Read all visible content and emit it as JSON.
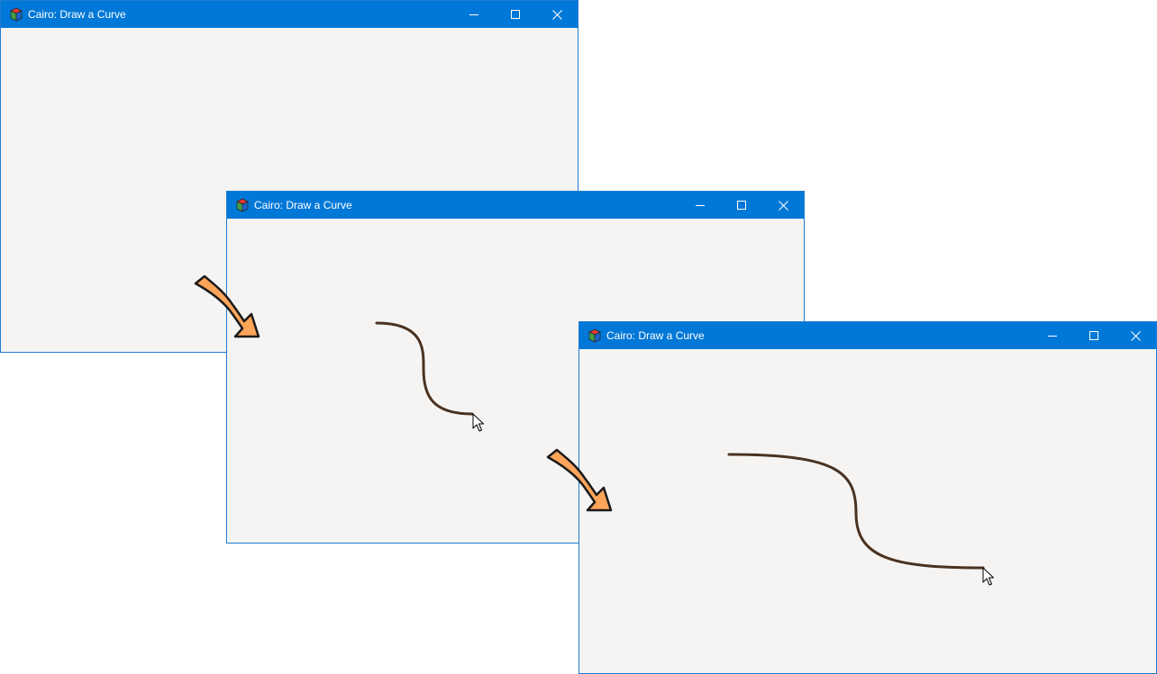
{
  "windows": [
    {
      "title": "Cairo: Draw a Curve",
      "canvas_state": "empty"
    },
    {
      "title": "Cairo: Draw a Curve",
      "canvas_state": "short curve drawn"
    },
    {
      "title": "Cairo: Draw a Curve",
      "canvas_state": "long curve drawn"
    }
  ],
  "icons": {
    "app": "gtk-cube-icon",
    "minimize": "minimize-icon",
    "maximize": "maximize-icon",
    "close": "close-icon",
    "cursor": "mouse-pointer-icon",
    "step_arrow": "step-arrow-icon"
  },
  "colors": {
    "titlebar": "#0078d7",
    "window_border": "#1e7bd3",
    "canvas": "#f5f4f3",
    "curve": "#4a3220",
    "step_arrow_fill": "#ffa55a",
    "step_arrow_stroke": "#1a1a1a"
  }
}
